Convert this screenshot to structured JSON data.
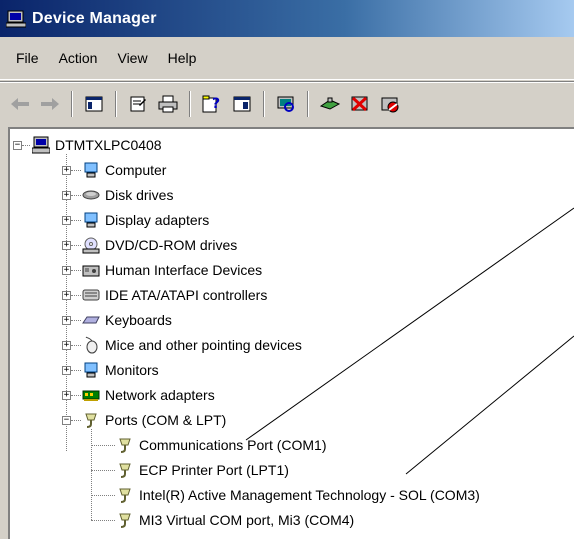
{
  "window": {
    "title": "Device Manager"
  },
  "menu": [
    "File",
    "Action",
    "View",
    "Help"
  ],
  "toolbar": {
    "buttons": [
      "back-icon",
      "forward-icon",
      "show-hide-tree-icon",
      "properties-icon",
      "print-icon",
      "help-icon",
      "console-tree-icon",
      "scan-hardware-icon",
      "update-driver-icon",
      "uninstall-icon",
      "disable-icon"
    ]
  },
  "tree": {
    "root": "DTMTXLPC0408",
    "categories": [
      "Computer",
      "Disk drives",
      "Display adapters",
      "DVD/CD-ROM drives",
      "Human Interface Devices",
      "IDE ATA/ATAPI controllers",
      "Keyboards",
      "Mice and other pointing devices",
      "Monitors",
      "Network adapters",
      "Ports (COM & LPT)"
    ],
    "ports": [
      "Communications Port (COM1)",
      "ECP Printer Port (LPT1)",
      "Intel(R) Active Management Technology - SOL (COM3)",
      "MI3 Virtual COM port, Mi3 (COM4)"
    ]
  }
}
